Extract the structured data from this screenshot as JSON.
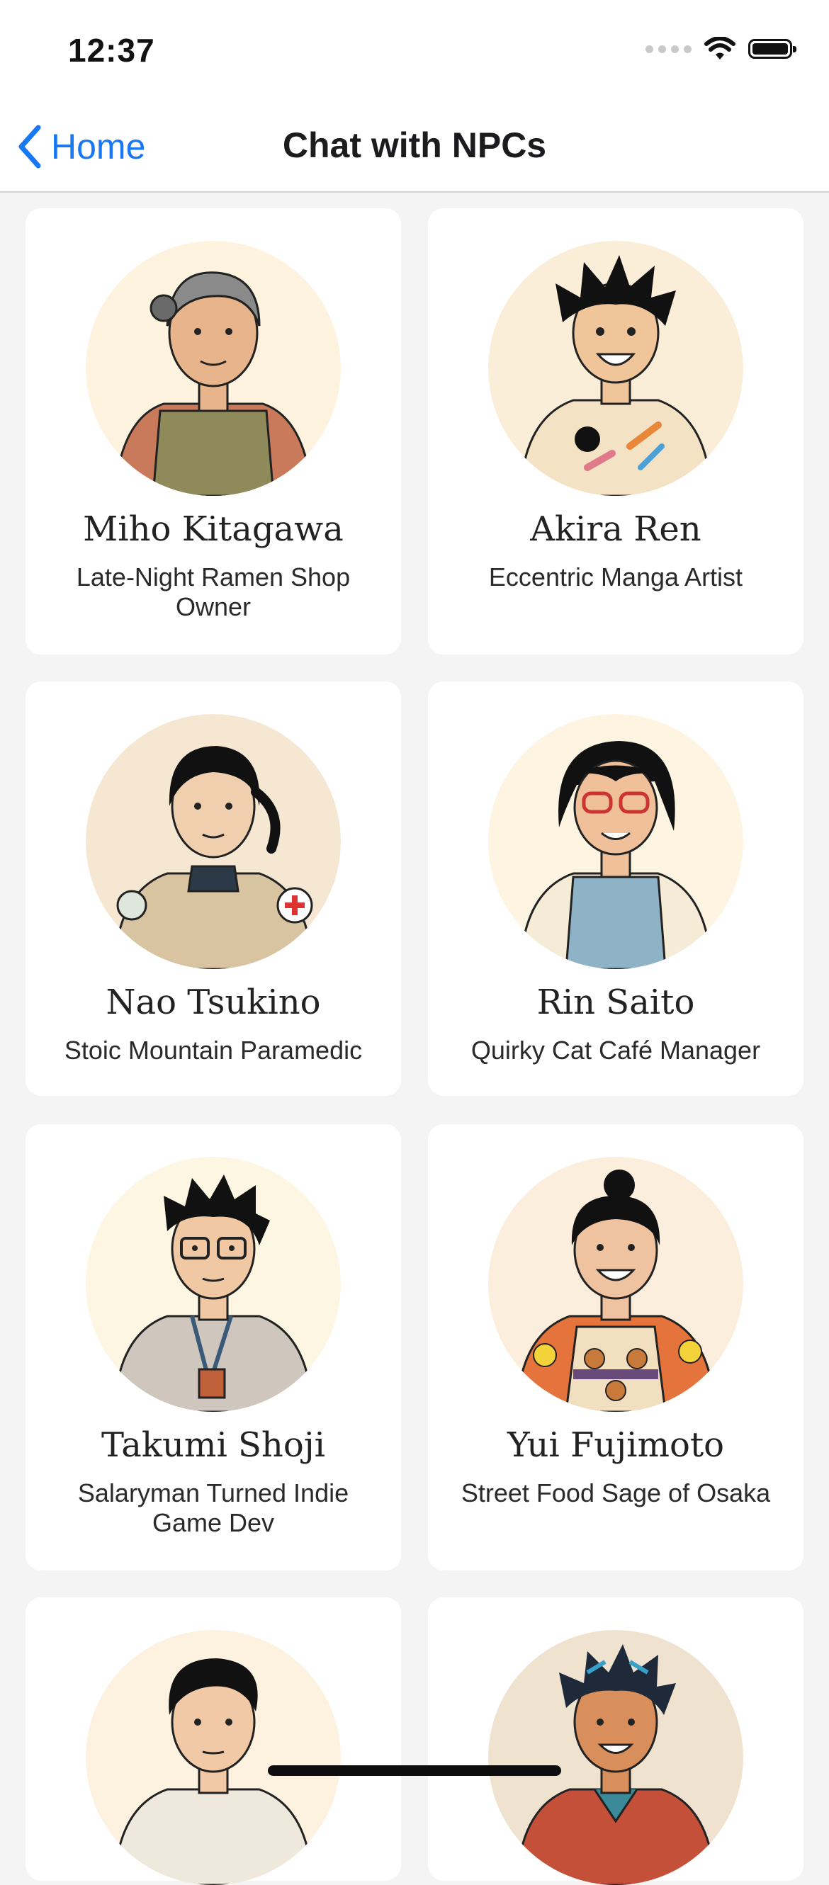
{
  "status_bar": {
    "time": "12:37"
  },
  "nav": {
    "back_label": "Home",
    "title": "Chat with NPCs"
  },
  "npcs": [
    {
      "name": "Miho Kitagawa",
      "role": "Late-Night Ramen Shop Owner"
    },
    {
      "name": "Akira Ren",
      "role": "Eccentric Manga Artist"
    },
    {
      "name": "Nao Tsukino",
      "role": "Stoic Mountain Paramedic"
    },
    {
      "name": "Rin Saito",
      "role": "Quirky Cat Café Manager"
    },
    {
      "name": "Takumi Shoji",
      "role": "Salaryman Turned Indie Game Dev"
    },
    {
      "name": "Yui Fujimoto",
      "role": "Street Food Sage of Osaka"
    }
  ],
  "colors": {
    "accent": "#1877f2",
    "background": "#f4f4f5",
    "card": "#ffffff"
  }
}
